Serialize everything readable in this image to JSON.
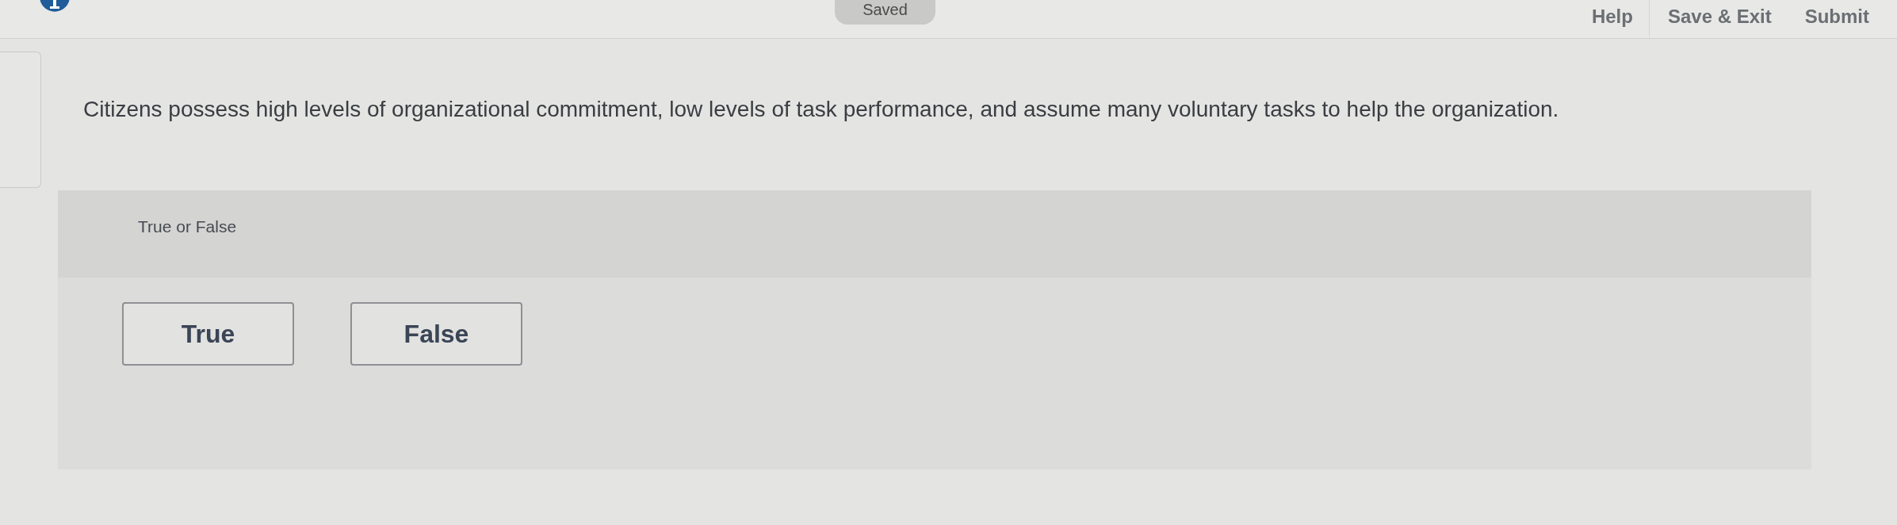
{
  "header": {
    "status_badge": "Saved",
    "links": [
      {
        "label": "Help"
      },
      {
        "label": "Save & Exit"
      },
      {
        "label": "Submit"
      }
    ]
  },
  "question": {
    "prompt": "Citizens possess high levels of organizational commitment, low levels of task performance, and assume many voluntary tasks to help the organization.",
    "answer_panel": {
      "instruction": "True or False",
      "options": [
        {
          "label": "True",
          "selected": false
        },
        {
          "label": "False",
          "selected": false
        }
      ]
    }
  }
}
